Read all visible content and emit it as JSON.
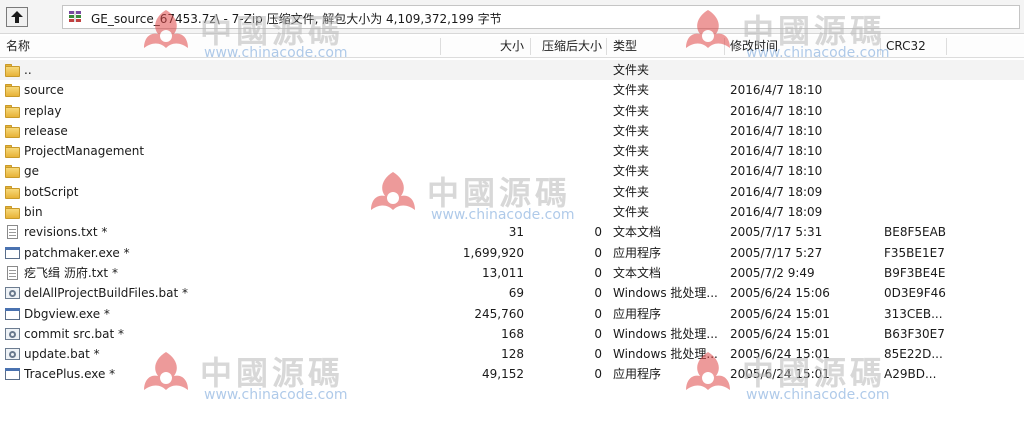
{
  "path_bar": {
    "path": "GE_source_67453.7z\\ - 7-Zip 压缩文件, 解包大小为 4,109,372,199 字节"
  },
  "columns": {
    "name": "名称",
    "size": "大小",
    "packed": "压缩后大小",
    "type": "类型",
    "modified": "修改时间",
    "crc": "CRC32"
  },
  "rows": [
    {
      "kind": "folder",
      "name": "..",
      "size": "",
      "packed": "",
      "type": "文件夹",
      "modified": "",
      "crc": ""
    },
    {
      "kind": "folder",
      "name": "source",
      "size": "",
      "packed": "",
      "type": "文件夹",
      "modified": "2016/4/7 18:10",
      "crc": ""
    },
    {
      "kind": "folder",
      "name": "replay",
      "size": "",
      "packed": "",
      "type": "文件夹",
      "modified": "2016/4/7 18:10",
      "crc": ""
    },
    {
      "kind": "folder",
      "name": "release",
      "size": "",
      "packed": "",
      "type": "文件夹",
      "modified": "2016/4/7 18:10",
      "crc": ""
    },
    {
      "kind": "folder",
      "name": "ProjectManagement",
      "size": "",
      "packed": "",
      "type": "文件夹",
      "modified": "2016/4/7 18:10",
      "crc": ""
    },
    {
      "kind": "folder",
      "name": "ge",
      "size": "",
      "packed": "",
      "type": "文件夹",
      "modified": "2016/4/7 18:10",
      "crc": ""
    },
    {
      "kind": "folder",
      "name": "botScript",
      "size": "",
      "packed": "",
      "type": "文件夹",
      "modified": "2016/4/7 18:09",
      "crc": ""
    },
    {
      "kind": "folder",
      "name": "bin",
      "size": "",
      "packed": "",
      "type": "文件夹",
      "modified": "2016/4/7 18:09",
      "crc": ""
    },
    {
      "kind": "doc",
      "name": "revisions.txt *",
      "size": "31",
      "packed": "0",
      "type": "文本文档",
      "modified": "2005/7/17 5:31",
      "crc": "BE8F5EAB"
    },
    {
      "kind": "exe",
      "name": "patchmaker.exe *",
      "size": "1,699,920",
      "packed": "0",
      "type": "应用程序",
      "modified": "2005/7/17 5:27",
      "crc": "F35BE1E7"
    },
    {
      "kind": "doc",
      "name": "疙飞缉 沥府.txt *",
      "size": "13,011",
      "packed": "0",
      "type": "文本文档",
      "modified": "2005/7/2 9:49",
      "crc": "B9F3BE4E"
    },
    {
      "kind": "bat",
      "name": "delAllProjectBuildFiles.bat *",
      "size": "69",
      "packed": "0",
      "type": "Windows 批处理...",
      "modified": "2005/6/24 15:06",
      "crc": "0D3E9F46"
    },
    {
      "kind": "exe",
      "name": "Dbgview.exe *",
      "size": "245,760",
      "packed": "0",
      "type": "应用程序",
      "modified": "2005/6/24 15:01",
      "crc": "313CEB..."
    },
    {
      "kind": "bat",
      "name": "commit src.bat *",
      "size": "168",
      "packed": "0",
      "type": "Windows 批处理...",
      "modified": "2005/6/24 15:01",
      "crc": "B63F30E7"
    },
    {
      "kind": "bat",
      "name": "update.bat *",
      "size": "128",
      "packed": "0",
      "type": "Windows 批处理...",
      "modified": "2005/6/24 15:01",
      "crc": "85E22D..."
    },
    {
      "kind": "exe",
      "name": "TracePlus.exe *",
      "size": "49,152",
      "packed": "0",
      "type": "应用程序",
      "modified": "2005/6/24 15:01",
      "crc": "A29BD..."
    }
  ],
  "watermark": {
    "title": "中國源碼",
    "url": "www.chinacode.com"
  },
  "icons": {
    "up": "up-folder-icon",
    "archive": "archive-icon",
    "folder": "folder-icon",
    "doc": "text-file-icon",
    "exe": "exe-file-icon",
    "bat": "batch-file-icon",
    "watermark_logo": "biohazard-logo-icon"
  },
  "colors": {
    "folder": "#e7b338",
    "watermark_logo": "#e04848",
    "watermark_url": "#6f9fd8"
  }
}
